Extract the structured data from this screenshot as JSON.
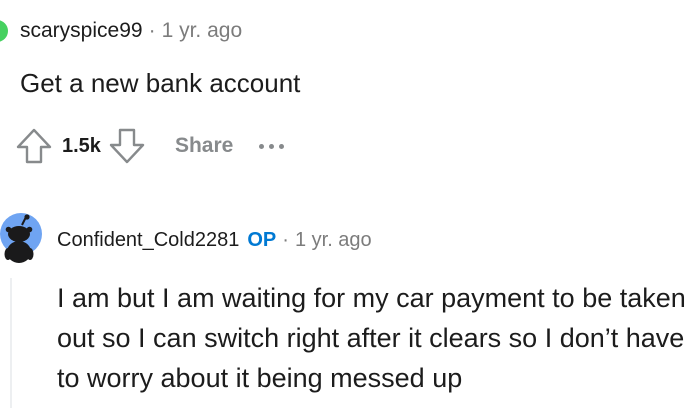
{
  "colors": {
    "text": "#1c1c1c",
    "meta_gray": "#7c7c7c",
    "action_gray": "#878a8c",
    "op_blue": "#0079d3",
    "avatar_green": "#46d160",
    "avatar_blue": "#6fa4f2"
  },
  "comment": {
    "author": "scaryspice99",
    "separator": "·",
    "time": "1 yr. ago",
    "body": "Get a new bank account",
    "score": "1.5k",
    "share_label": "Share",
    "upvote_icon": "upvote-arrow-icon",
    "downvote_icon": "downvote-arrow-icon",
    "more_icon": "more-options-icon"
  },
  "reply": {
    "author": "Confident_Cold2281",
    "op_badge": "OP",
    "separator": "·",
    "time": "1 yr. ago",
    "body": "I am but I am waiting for my car payment to be taken out so I can switch right after it clears so I don’t have to worry about it being messed up",
    "avatar_icon": "snoo-avatar-icon"
  }
}
